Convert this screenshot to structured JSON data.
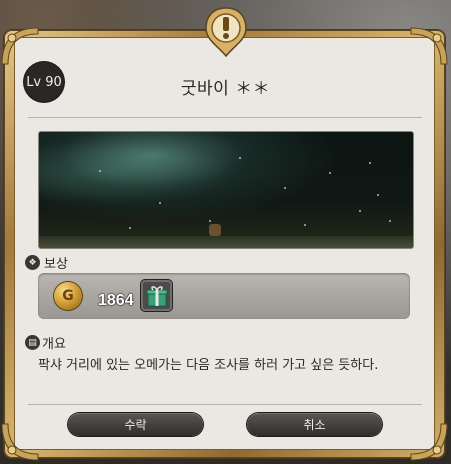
{
  "quest": {
    "level_label": "Lv 90",
    "title": "굿바이 ＊＊"
  },
  "rewards": {
    "section_label": "보상",
    "gil_count": "1864"
  },
  "overview": {
    "section_label": "개요",
    "description": "팍샤 거리에 있는 오메가는 다음 조사를 하러 가고 싶은 듯하다."
  },
  "buttons": {
    "accept_label": "수락",
    "cancel_label": "취소"
  },
  "icons": {
    "quest_marker": "exclamation-icon",
    "reward_section": "reward-icon",
    "overview_section": "book-icon",
    "currency": "gil-coin-icon",
    "item": "gift-box-icon"
  },
  "colors": {
    "frame_gold": "#c9a45a",
    "panel_bg": "#ebe8e3",
    "button_dark": "#3c3a36",
    "gift_green": "#3aa07a"
  }
}
